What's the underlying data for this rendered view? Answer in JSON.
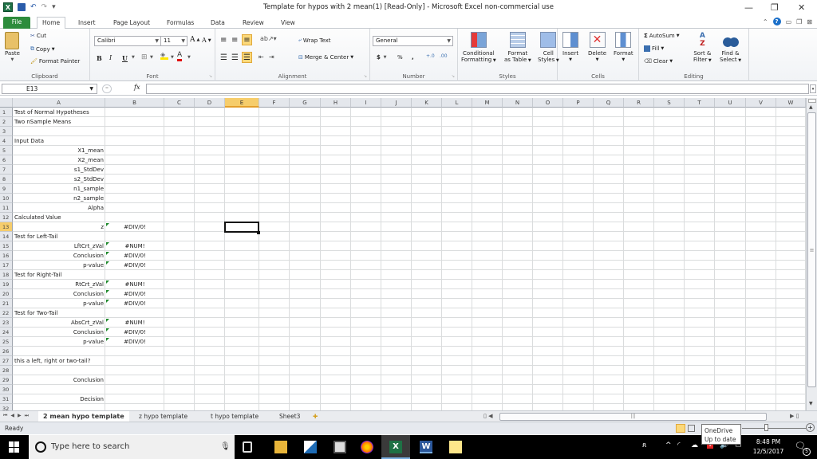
{
  "window": {
    "title": "Template for hypos with 2 mean(1)  [Read-Only]  -  Microsoft Excel non-commercial use",
    "minimize": "—",
    "restore": "❐",
    "close": "✕"
  },
  "quick_access": {
    "app_icon": "X",
    "save_icon": "💾",
    "undo_icon": "↶",
    "redo_icon": "↷",
    "customize_icon": "▾"
  },
  "ribbon_tabs": [
    "File",
    "Home",
    "Insert",
    "Page Layout",
    "Formulas",
    "Data",
    "Review",
    "View"
  ],
  "ribbon": {
    "clipboard": {
      "paste": "Paste",
      "cut": "Cut",
      "copy": "Copy",
      "format_painter": "Format Painter",
      "label": "Clipboard"
    },
    "font": {
      "font_name": "Calibri",
      "font_size": "11",
      "bold": "B",
      "italic": "I",
      "underline": "U",
      "label": "Font"
    },
    "alignment": {
      "wrap_text": "Wrap Text",
      "merge_center": "Merge & Center",
      "label": "Alignment"
    },
    "number": {
      "format": "General",
      "currency": "$",
      "percent": "%",
      "comma": ",",
      "inc_decimal": "+.0",
      "dec_decimal": ".00",
      "label": "Number"
    },
    "styles": {
      "conditional_formatting": [
        "Conditional",
        "Formatting"
      ],
      "format_as_table": [
        "Format",
        "as Table"
      ],
      "cell_styles": [
        "Cell",
        "Styles"
      ],
      "label": "Styles"
    },
    "cells": {
      "insert": "Insert",
      "delete": "Delete",
      "format": "Format",
      "label": "Cells"
    },
    "editing": {
      "autosum": "AutoSum",
      "fill": "Fill",
      "clear": "Clear",
      "sort_filter": [
        "Sort &",
        "Filter"
      ],
      "find_select": [
        "Find &",
        "Select"
      ],
      "label": "Editing"
    }
  },
  "formula_bar": {
    "name_box": "E13",
    "fx": "fx",
    "formula": ""
  },
  "sheet": {
    "columns": [
      "A",
      "B",
      "C",
      "D",
      "E",
      "F",
      "G",
      "H",
      "I",
      "J",
      "K",
      "L",
      "M",
      "N",
      "O",
      "P",
      "Q",
      "R",
      "S",
      "T",
      "U",
      "V",
      "W"
    ],
    "selected_cell": "E13",
    "rows": [
      {
        "n": "1",
        "a": "Test of Normal Hypotheses",
        "a_align": "left",
        "b": ""
      },
      {
        "n": "2",
        "a": "Two nSample Means",
        "a_align": "left",
        "b": ""
      },
      {
        "n": "3",
        "a": "",
        "a_align": "left",
        "b": ""
      },
      {
        "n": "4",
        "a": "Input Data",
        "a_align": "left",
        "b": ""
      },
      {
        "n": "5",
        "a": "X1_mean",
        "a_align": "right",
        "b": ""
      },
      {
        "n": "6",
        "a": "X2_mean",
        "a_align": "right",
        "b": ""
      },
      {
        "n": "7",
        "a": "s1_StdDev",
        "a_align": "right",
        "b": ""
      },
      {
        "n": "8",
        "a": "s2_StdDev",
        "a_align": "right",
        "b": ""
      },
      {
        "n": "9",
        "a": "n1_sample",
        "a_align": "right",
        "b": ""
      },
      {
        "n": "10",
        "a": "n2_sample",
        "a_align": "right",
        "b": ""
      },
      {
        "n": "11",
        "a": "Alpha",
        "a_align": "right",
        "b": ""
      },
      {
        "n": "12",
        "a": "Calculated Value",
        "a_align": "left",
        "b": ""
      },
      {
        "n": "13",
        "a": "z",
        "a_align": "right",
        "b": "#DIV/0!",
        "err": true
      },
      {
        "n": "14",
        "a": "Test for Left-Tail",
        "a_align": "left",
        "b": ""
      },
      {
        "n": "15",
        "a": "LftCrt_zVal",
        "a_align": "right",
        "b": "#NUM!",
        "err": true
      },
      {
        "n": "16",
        "a": "Conclusion",
        "a_align": "right",
        "b": "#DIV/0!",
        "err": true
      },
      {
        "n": "17",
        "a": "p-value",
        "a_align": "right",
        "b": "#DIV/0!",
        "err": true
      },
      {
        "n": "18",
        "a": "Test for Right-Tail",
        "a_align": "left",
        "b": ""
      },
      {
        "n": "19",
        "a": "RtCrt_zVal",
        "a_align": "right",
        "b": "#NUM!",
        "err": true
      },
      {
        "n": "20",
        "a": "Conclusion",
        "a_align": "right",
        "b": "#DIV/0!",
        "err": true
      },
      {
        "n": "21",
        "a": "p-value",
        "a_align": "right",
        "b": "#DIV/0!",
        "err": true
      },
      {
        "n": "22",
        "a": "Test for Two-Tail",
        "a_align": "left",
        "b": ""
      },
      {
        "n": "23",
        "a": "AbsCrt_zVal",
        "a_align": "right",
        "b": "#NUM!",
        "err": true
      },
      {
        "n": "24",
        "a": "Conclusion",
        "a_align": "right",
        "b": "#DIV/0!",
        "err": true
      },
      {
        "n": "25",
        "a": "p-value",
        "a_align": "right",
        "b": "#DIV/0!",
        "err": true
      },
      {
        "n": "26",
        "a": "",
        "a_align": "left",
        "b": ""
      },
      {
        "n": "27",
        "a": "this a left, right or two-tail?",
        "a_align": "left",
        "b": ""
      },
      {
        "n": "28",
        "a": "",
        "a_align": "left",
        "b": ""
      },
      {
        "n": "29",
        "a": "Conclusion",
        "a_align": "right",
        "b": ""
      },
      {
        "n": "30",
        "a": "",
        "a_align": "left",
        "b": ""
      },
      {
        "n": "31",
        "a": "Decision",
        "a_align": "right",
        "b": ""
      },
      {
        "n": "32",
        "a": "",
        "a_align": "left",
        "b": ""
      }
    ]
  },
  "sheet_tabs": [
    "2 mean hypo template",
    "z hypo template",
    "t hypo template",
    "Sheet3"
  ],
  "active_sheet": "2 mean hypo template",
  "status_bar": {
    "status": "Ready"
  },
  "tooltip": {
    "line1": "OneDrive",
    "line2": "Up to date"
  },
  "taskbar": {
    "search_placeholder": "Type here to search",
    "time": "8:48 PM",
    "date": "12/5/2017",
    "notification_count": "5"
  },
  "colors": {
    "excel_green": "#1e7145",
    "file_tab": "#2d8c3c",
    "selected_header": "#f6cd6b",
    "error_triangle": "#1f8a2c"
  }
}
